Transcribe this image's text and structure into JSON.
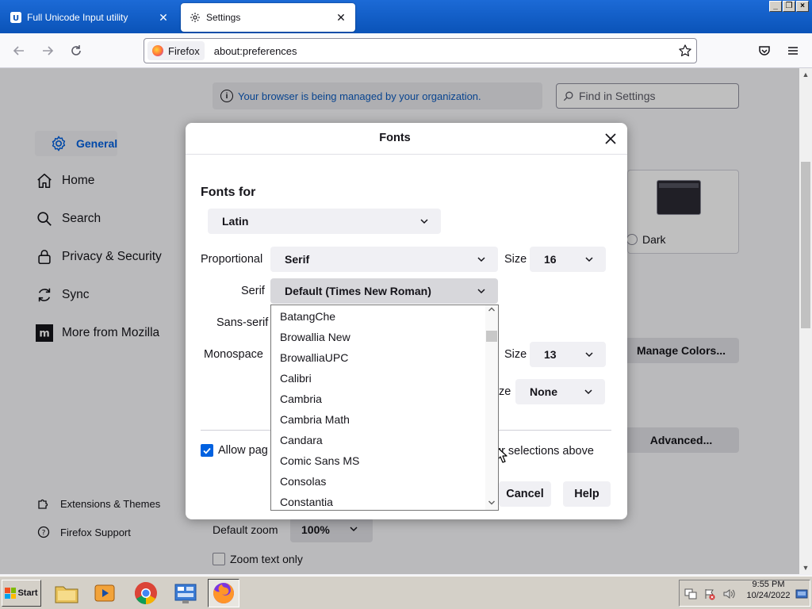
{
  "tabs": [
    {
      "title": "Full Unicode Input utility",
      "icon": "unicode-icon",
      "active": false
    },
    {
      "title": "Settings",
      "icon": "gear-icon",
      "active": true
    }
  ],
  "window_buttons": [
    "_",
    "❐",
    "×"
  ],
  "navbar": {
    "identity_label": "Firefox",
    "url": "about:preferences"
  },
  "settings": {
    "managed_notice": "Your browser is being managed by your organization.",
    "find_placeholder": "Find in Settings",
    "sidebar": [
      {
        "label": "General",
        "icon": "gear-icon",
        "selected": true
      },
      {
        "label": "Home",
        "icon": "home-icon",
        "selected": false
      },
      {
        "label": "Search",
        "icon": "search-icon",
        "selected": false
      },
      {
        "label": "Privacy & Security",
        "icon": "lock-icon",
        "selected": false
      },
      {
        "label": "Sync",
        "icon": "sync-icon",
        "selected": false
      },
      {
        "label": "More from Mozilla",
        "icon": "mozilla-icon",
        "selected": false
      }
    ],
    "sidebar_footer": [
      {
        "label": "Extensions & Themes",
        "icon": "puzzle-icon"
      },
      {
        "label": "Firefox Support",
        "icon": "help-icon"
      }
    ],
    "theme_dark_label": "Dark",
    "manage_colors": "Manage Colors...",
    "advanced": "Advanced...",
    "default_zoom_label": "Default zoom",
    "default_zoom_value": "100%",
    "zoom_text_only": "Zoom text only"
  },
  "dialog": {
    "title": "Fonts",
    "fonts_for_label": "Fonts for",
    "fonts_for_value": "Latin",
    "proportional_label": "Proportional",
    "proportional_value": "Serif",
    "size_label": "Size",
    "proportional_size": "16",
    "serif_label": "Serif",
    "serif_value": "Default (Times New Roman)",
    "sans_serif_label": "Sans-serif",
    "monospace_label": "Monospace",
    "monospace_size": "13",
    "minimum_size_label_tail": "ze",
    "minimum_size_value": "None",
    "allow_label_visible": "Allow pag",
    "allow_label_tail": "ur selections above",
    "allow_checked": true,
    "cancel": "Cancel",
    "help": "Help"
  },
  "font_dropdown": [
    "BatangChe",
    "Browallia New",
    "BrowalliaUPC",
    "Calibri",
    "Cambria",
    "Cambria Math",
    "Candara",
    "Comic Sans MS",
    "Consolas",
    "Constantia"
  ],
  "taskbar": {
    "start_label": "Start",
    "apps": [
      "file-explorer-icon",
      "media-player-icon",
      "chrome-icon",
      "control-panel-icon",
      "firefox-icon"
    ],
    "time": "9:55 PM",
    "date": "10/24/2022"
  },
  "colors": {
    "accent": "#0061e0",
    "titlebar": "#0a53b8",
    "taskbar": "#d4d0c8"
  }
}
